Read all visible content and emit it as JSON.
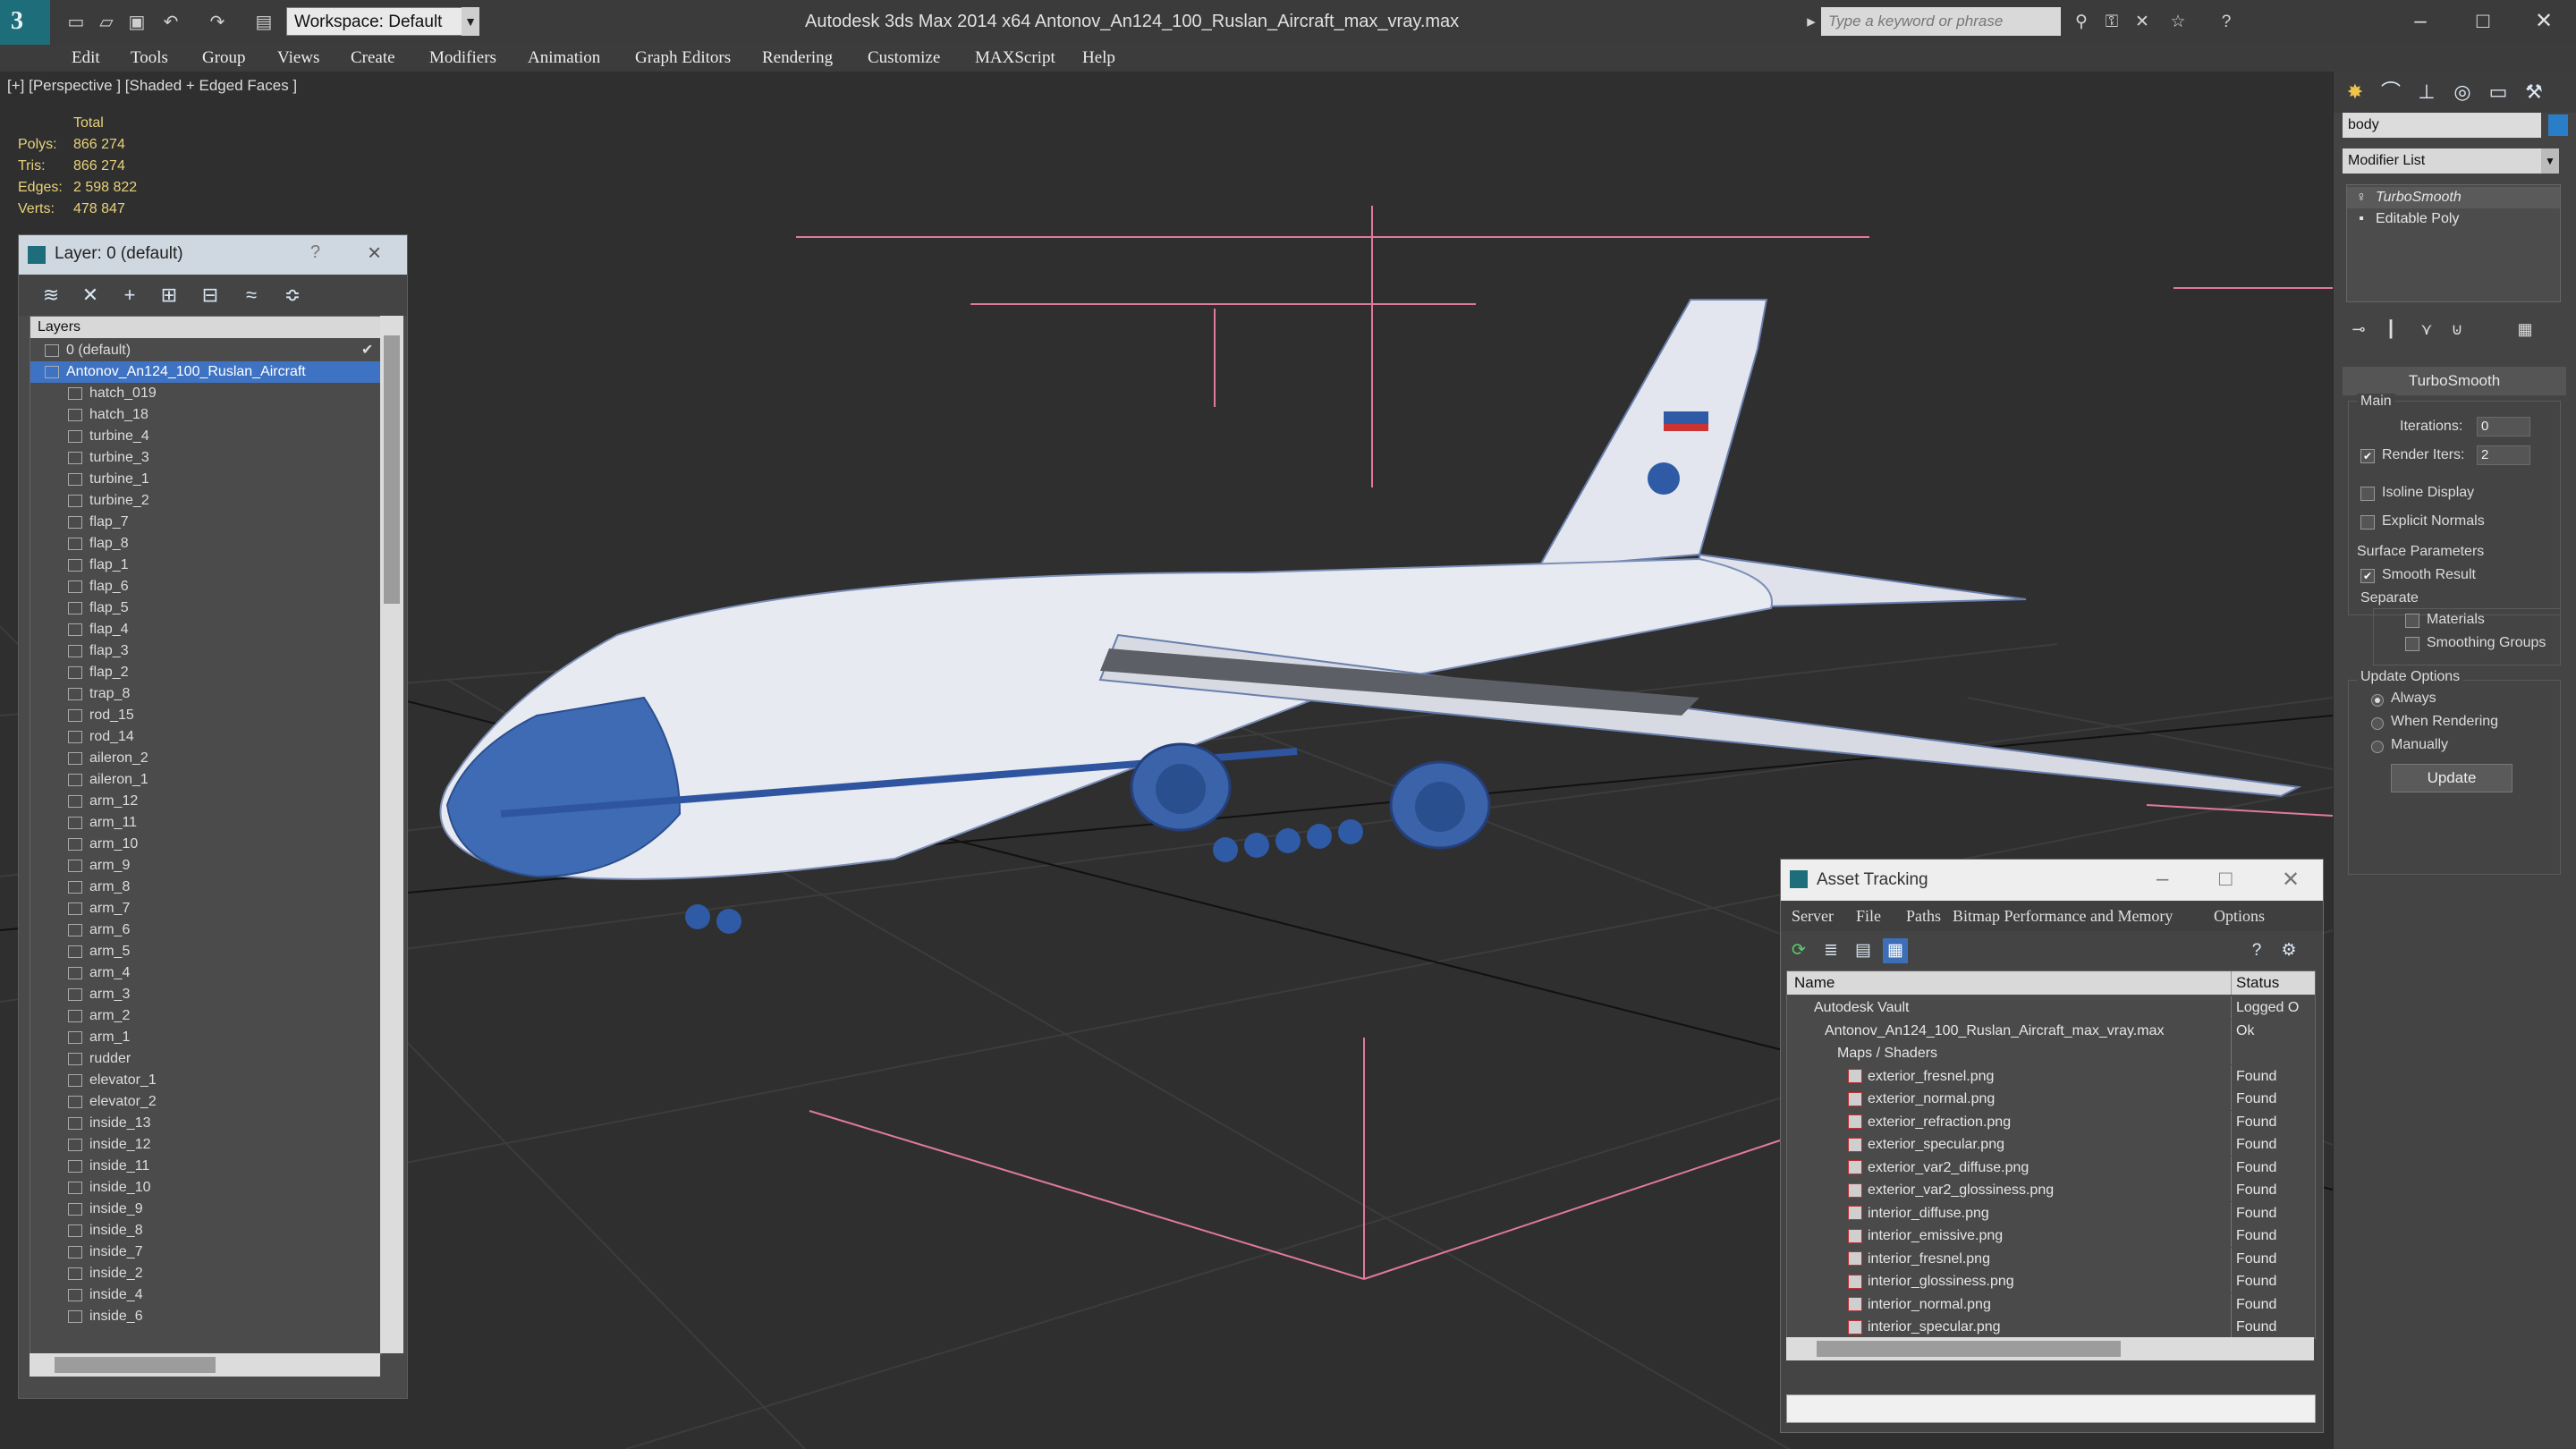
{
  "app": {
    "title": "Autodesk 3ds Max  2014 x64      Antonov_An124_100_Ruslan_Aircraft_max_vray.max",
    "workspace": "Workspace: Default",
    "search_placeholder": "Type a keyword or phrase"
  },
  "menu": [
    "Edit",
    "Tools",
    "Group",
    "Views",
    "Create",
    "Modifiers",
    "Animation",
    "Graph Editors",
    "Rendering",
    "Customize",
    "MAXScript",
    "Help"
  ],
  "viewport": {
    "label": "[+] [Perspective ] [Shaded + Edged Faces ]",
    "stats_header": "Total",
    "stats": [
      {
        "label": "Polys:",
        "value": "866 274"
      },
      {
        "label": "Tris:",
        "value": "866 274"
      },
      {
        "label": "Edges:",
        "value": "2 598 822"
      },
      {
        "label": "Verts:",
        "value": "478 847"
      }
    ]
  },
  "layer_panel": {
    "title": "Layer: 0 (default)",
    "help": "?",
    "column": "Layers",
    "items": [
      "0 (default)",
      "Antonov_An124_100_Ruslan_Aircraft",
      "hatch_019",
      "hatch_18",
      "turbine_4",
      "turbine_3",
      "turbine_1",
      "turbine_2",
      "flap_7",
      "flap_8",
      "flap_1",
      "flap_6",
      "flap_5",
      "flap_4",
      "flap_3",
      "flap_2",
      "trap_8",
      "rod_15",
      "rod_14",
      "aileron_2",
      "aileron_1",
      "arm_12",
      "arm_11",
      "arm_10",
      "arm_9",
      "arm_8",
      "arm_7",
      "arm_6",
      "arm_5",
      "arm_4",
      "arm_3",
      "arm_2",
      "arm_1",
      "rudder",
      "elevator_1",
      "elevator_2",
      "inside_13",
      "inside_12",
      "inside_11",
      "inside_10",
      "inside_9",
      "inside_8",
      "inside_7",
      "inside_2",
      "inside_4",
      "inside_6"
    ]
  },
  "command_panel": {
    "object_name": "body",
    "modifier_list": "Modifier List",
    "stack": [
      "TurboSmooth",
      "Editable Poly"
    ],
    "rollout": "TurboSmooth",
    "main": "Main",
    "iterations_label": "Iterations:",
    "iterations": "0",
    "render_iters_label": "Render Iters:",
    "render_iters": "2",
    "isoline": "Isoline Display",
    "explicit": "Explicit Normals",
    "surface": "Surface Parameters",
    "smooth_result": "Smooth Result",
    "separate": "Separate",
    "materials": "Materials",
    "smoothing_groups": "Smoothing Groups",
    "update_options": "Update Options",
    "always": "Always",
    "when_rendering": "When Rendering",
    "manually": "Manually",
    "update": "Update"
  },
  "asset_tracking": {
    "title": "Asset Tracking",
    "menu": [
      "Server",
      "File",
      "Paths",
      "Bitmap Performance and Memory",
      "Options"
    ],
    "col_name": "Name",
    "col_status": "Status",
    "rows": [
      {
        "name": "Autodesk Vault",
        "status": "Logged O",
        "indent": 30
      },
      {
        "name": "Antonov_An124_100_Ruslan_Aircraft_max_vray.max",
        "status": "Ok",
        "indent": 42
      },
      {
        "name": "Maps / Shaders",
        "status": "",
        "indent": 56
      },
      {
        "name": "exterior_fresnel.png",
        "status": "Found",
        "indent": 68
      },
      {
        "name": "exterior_normal.png",
        "status": "Found",
        "indent": 68
      },
      {
        "name": "exterior_refraction.png",
        "status": "Found",
        "indent": 68
      },
      {
        "name": "exterior_specular.png",
        "status": "Found",
        "indent": 68
      },
      {
        "name": "exterior_var2_diffuse.png",
        "status": "Found",
        "indent": 68
      },
      {
        "name": "exterior_var2_glossiness.png",
        "status": "Found",
        "indent": 68
      },
      {
        "name": "interior_diffuse.png",
        "status": "Found",
        "indent": 68
      },
      {
        "name": "interior_emissive.png",
        "status": "Found",
        "indent": 68
      },
      {
        "name": "interior_fresnel.png",
        "status": "Found",
        "indent": 68
      },
      {
        "name": "interior_glossiness.png",
        "status": "Found",
        "indent": 68
      },
      {
        "name": "interior_normal.png",
        "status": "Found",
        "indent": 68
      },
      {
        "name": "interior_specular.png",
        "status": "Found",
        "indent": 68
      }
    ]
  }
}
